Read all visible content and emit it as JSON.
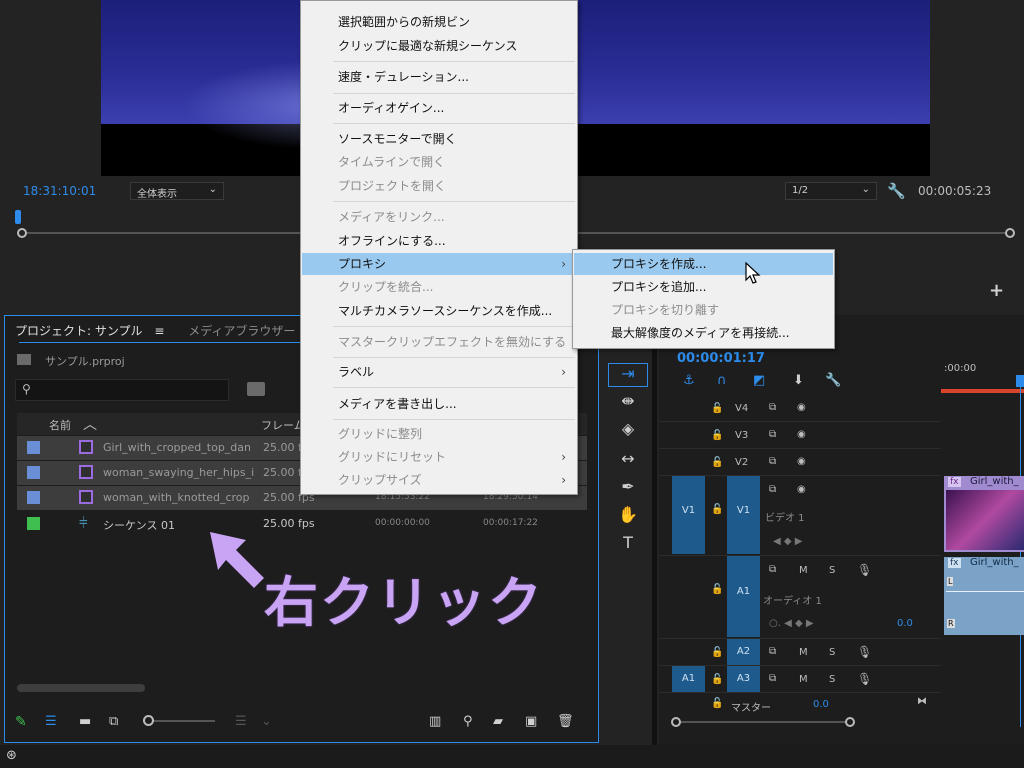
{
  "monitor": {
    "timecode_left": "18:31:10:01",
    "fit_label": "全体表示",
    "quality_label": "1/2",
    "timecode_right": "00:00:05:23"
  },
  "context_menu": {
    "items": [
      {
        "label": "選択範囲からの新規ビン",
        "disabled": false
      },
      {
        "label": "クリップに最適な新規シーケンス",
        "disabled": false
      },
      {
        "label": "速度・デュレーション...",
        "disabled": false
      },
      {
        "label": "オーディオゲイン...",
        "disabled": false
      },
      {
        "label": "ソースモニターで開く",
        "disabled": false
      },
      {
        "label": "タイムラインで開く",
        "disabled": true
      },
      {
        "label": "プロジェクトを開く",
        "disabled": true
      },
      {
        "label": "メディアをリンク...",
        "disabled": true
      },
      {
        "label": "オフラインにする...",
        "disabled": false
      },
      {
        "label": "プロキシ",
        "disabled": false
      },
      {
        "label": "クリップを統合...",
        "disabled": true
      },
      {
        "label": "マルチカメラソースシーケンスを作成...",
        "disabled": false
      },
      {
        "label": "マスタークリップエフェクトを無効にする",
        "disabled": true
      },
      {
        "label": "ラベル",
        "disabled": false
      },
      {
        "label": "メディアを書き出し...",
        "disabled": false
      },
      {
        "label": "グリッドに整列",
        "disabled": true
      },
      {
        "label": "グリッドにリセット",
        "disabled": true
      },
      {
        "label": "クリップサイズ",
        "disabled": true
      }
    ],
    "submenu_arrow": "›"
  },
  "proxy_submenu": {
    "items": [
      {
        "label": "プロキシを作成...",
        "disabled": false
      },
      {
        "label": "プロキシを追加...",
        "disabled": false
      },
      {
        "label": "プロキシを切り離す",
        "disabled": true
      },
      {
        "label": "最大解像度のメディアを再接続...",
        "disabled": false
      }
    ]
  },
  "project_panel": {
    "tab_project": "プロジェクト: サンプル",
    "tab_menu_icon": "≡",
    "tab_media_browser": "メディアブラウザー",
    "project_file": "サンプル.prproj",
    "search_placeholder": "",
    "col_name": "名前",
    "col_framerate": "フレーム",
    "rows": [
      {
        "name": "Girl_with_cropped_top_dan",
        "fps": "25.00 fps",
        "in": "",
        "out": "",
        "swatch": "#6b8fd6",
        "icon": "clip",
        "selected": true
      },
      {
        "name": "woman_swaying_her_hips_i",
        "fps": "25.00 fps",
        "in": "",
        "out": "",
        "swatch": "#6b8fd6",
        "icon": "clip",
        "selected": true
      },
      {
        "name": "woman_with_knotted_crop",
        "fps": "25.00 fps",
        "in": "18:15:53:22",
        "out": "18:29:50:14",
        "swatch": "#6b8fd6",
        "icon": "clip",
        "selected": true
      },
      {
        "name": "シーケンス 01",
        "fps": "25.00 fps",
        "in": "00:00:00:00",
        "out": "00:00:17:22",
        "swatch": "#3fbf4f",
        "icon": "sequence",
        "selected": false
      }
    ]
  },
  "annotation": {
    "text": "右クリック"
  },
  "timeline": {
    "timecode": "00:00:01:17",
    "ruler_start": ":00:00",
    "tracks_video": [
      {
        "name": "V4"
      },
      {
        "name": "V3"
      },
      {
        "name": "V2"
      },
      {
        "name": "V1",
        "source": "V1",
        "label": "ビデオ 1"
      }
    ],
    "tracks_audio": [
      {
        "name": "A1",
        "label": "オーディオ 1",
        "vol": "0.0"
      },
      {
        "name": "A2"
      },
      {
        "name": "A3",
        "source": "A1"
      }
    ],
    "master_label": "マスター",
    "master_vol": "0.0",
    "clip_video_name": "Girl_with_",
    "clip_audio_name": "Girl_with_",
    "mute_label": "M",
    "solo_label": "S"
  },
  "colors": {
    "accent": "#2d8ceb",
    "menu_highlight": "#99c9ef",
    "annotation": "#c9a3f4",
    "clip_purple": "#9b6be0",
    "track_blue": "#1e5b8c"
  }
}
